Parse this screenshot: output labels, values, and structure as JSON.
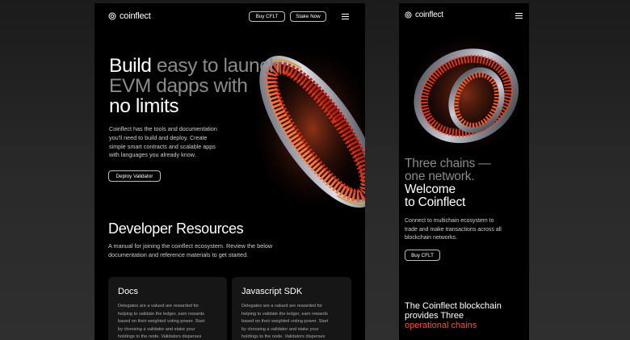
{
  "colors": {
    "accent_orange": "#ff4d24",
    "muted_gray": "#8a8a8a",
    "background": "#000000"
  },
  "desktop": {
    "logo": "coinflect",
    "nav": {
      "buy_label": "Buy CFLT",
      "stake_label": "Stake Now",
      "menu_icon": "hamburger-icon"
    },
    "hero": {
      "title_word1": "Build",
      "title_muted_1": "easy to launch",
      "title_muted_2": "EVM dapps with",
      "title_line3": "no limits",
      "description_lines": [
        "Coinflect has the tools and documentation",
        "you'll need to build and deploy. Create",
        "simple smart contracts and scalable apps",
        "with languages you already know."
      ],
      "cta_label": "Deploy Validator"
    },
    "resources": {
      "title": "Developer Resources",
      "description_lines": [
        "A manual for joining the coinflect ecosystem. Review the below",
        "documentation and reference materials to get started."
      ],
      "cards": [
        {
          "title": "Docs",
          "body_lines": [
            "Delegates are a valued are rewarded for",
            "helping to validate the ledger, earn rewards",
            "based on their weighted voting power. Start",
            "by choosing a validator and stake your",
            "holdings to the node. Validators disperses"
          ]
        },
        {
          "title": "Javascript SDK",
          "body_lines": [
            "Delegates are a valued are rewarded for",
            "helping to validate the ledger, earn rewards",
            "based on their weighted voting power. Start",
            "by choosing a validator and stake your",
            "holdings to the node. Validators disperses"
          ]
        }
      ]
    }
  },
  "mobile": {
    "logo": "coinflect",
    "menu_icon": "hamburger-icon",
    "hero": {
      "muted_line1": "Three chains —",
      "muted_line2": "one network.",
      "line3": "Welcome",
      "line4": "to Coinflect",
      "description_lines": [
        "Connect to multichain ecosystem to",
        "trade and make transactions across all",
        "blockchain networks."
      ],
      "cta_label": "Buy CFLT"
    },
    "chains": {
      "line1": "The Coinflect blockchain",
      "line2": "provides Three",
      "line3_orange": "operational chains"
    }
  }
}
